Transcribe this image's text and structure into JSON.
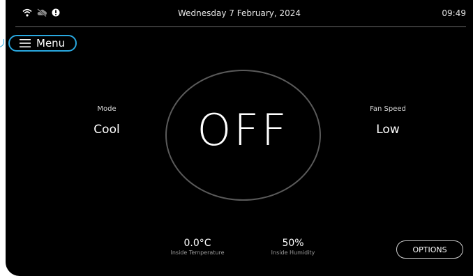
{
  "status_bar": {
    "date": "Wednesday 7 February, 2024",
    "time": "09:49",
    "icons": [
      "wifi-icon",
      "cloud-off-icon",
      "alert-icon"
    ]
  },
  "menu": {
    "label": "Menu",
    "accent_color": "#29a8e0"
  },
  "mode": {
    "title": "Mode",
    "value": "Cool"
  },
  "fan_speed": {
    "title": "Fan Speed",
    "value": "Low"
  },
  "power": {
    "state": "OFF"
  },
  "inside_temperature": {
    "value": "0.0°C",
    "label": "Inside Temperature"
  },
  "inside_humidity": {
    "value": "50%",
    "label": "Inside Humidity"
  },
  "options": {
    "label": "OPTIONS"
  }
}
